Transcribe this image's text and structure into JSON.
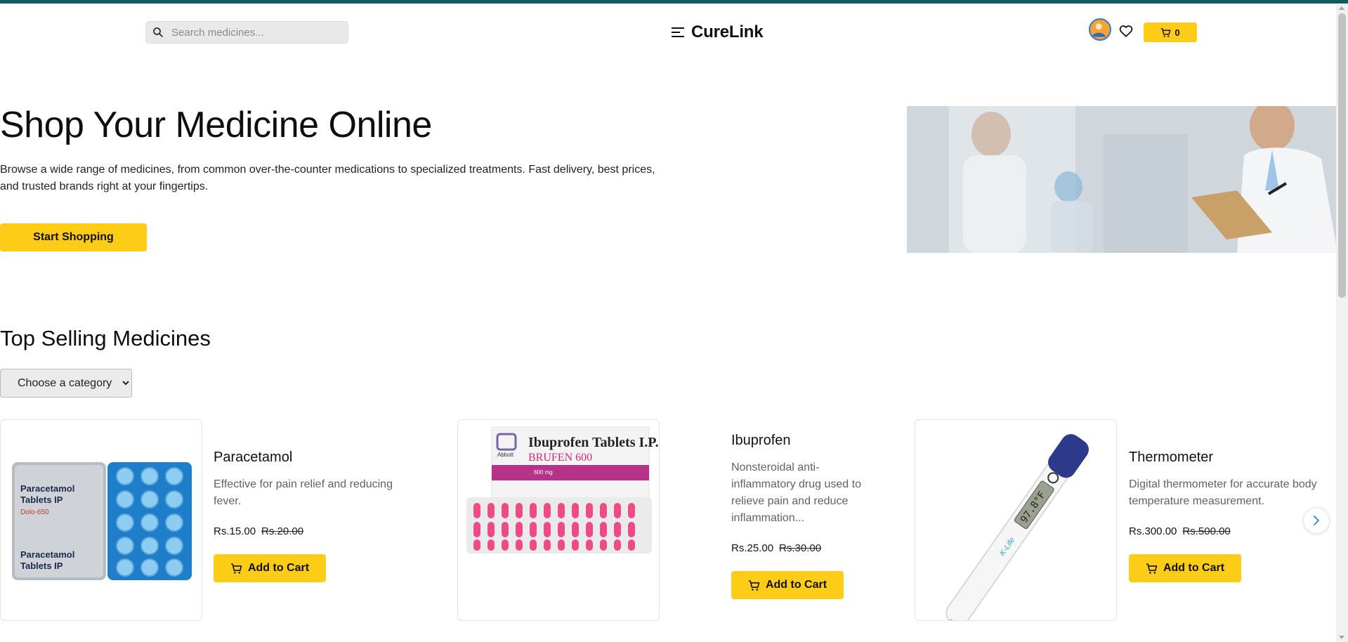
{
  "colors": {
    "accent": "#fccc17",
    "topbar": "#0b5c63"
  },
  "header": {
    "search_placeholder": "Search medicines...",
    "brand": "CureLink",
    "cart_count": "0",
    "icons": [
      "search-icon",
      "menu-icon",
      "avatar",
      "heart-icon",
      "cart-icon"
    ]
  },
  "hero": {
    "title": "Shop Your Medicine Online",
    "text": "Browse a wide range of medicines, from common over-the-counter medications to specialized treatments. Fast delivery, best prices, and trusted brands right at your fingertips.",
    "cta": "Start Shopping"
  },
  "top_selling": {
    "title": "Top Selling Medicines",
    "category_selected": "Choose a category"
  },
  "products": [
    {
      "name": "Paracetamol",
      "description": "Effective for pain relief and reducing fever.",
      "price": "Rs.15.00",
      "old_price": "Rs.20.00",
      "cta": "Add to Cart",
      "image_text": [
        "Paracetamol",
        "Tablets IP",
        "Dolo-650"
      ]
    },
    {
      "name": "Ibuprofen",
      "description": "Nonsteroidal anti-inflammatory drug used to relieve pain and reduce inflammation...",
      "price": "Rs.25.00",
      "old_price": "Rs.30.00",
      "cta": "Add to Cart",
      "image_text": [
        "Ibuprofen Tablets I.P.",
        "BRUFEN 600",
        "Abbott",
        "600 mg"
      ]
    },
    {
      "name": "Thermometer",
      "description": "Digital thermometer for accurate body temperature measurement.",
      "price": "Rs.300.00",
      "old_price": "Rs.500.00",
      "cta": "Add to Cart",
      "image_text": [
        "97.8°F",
        "K-Life"
      ]
    }
  ]
}
